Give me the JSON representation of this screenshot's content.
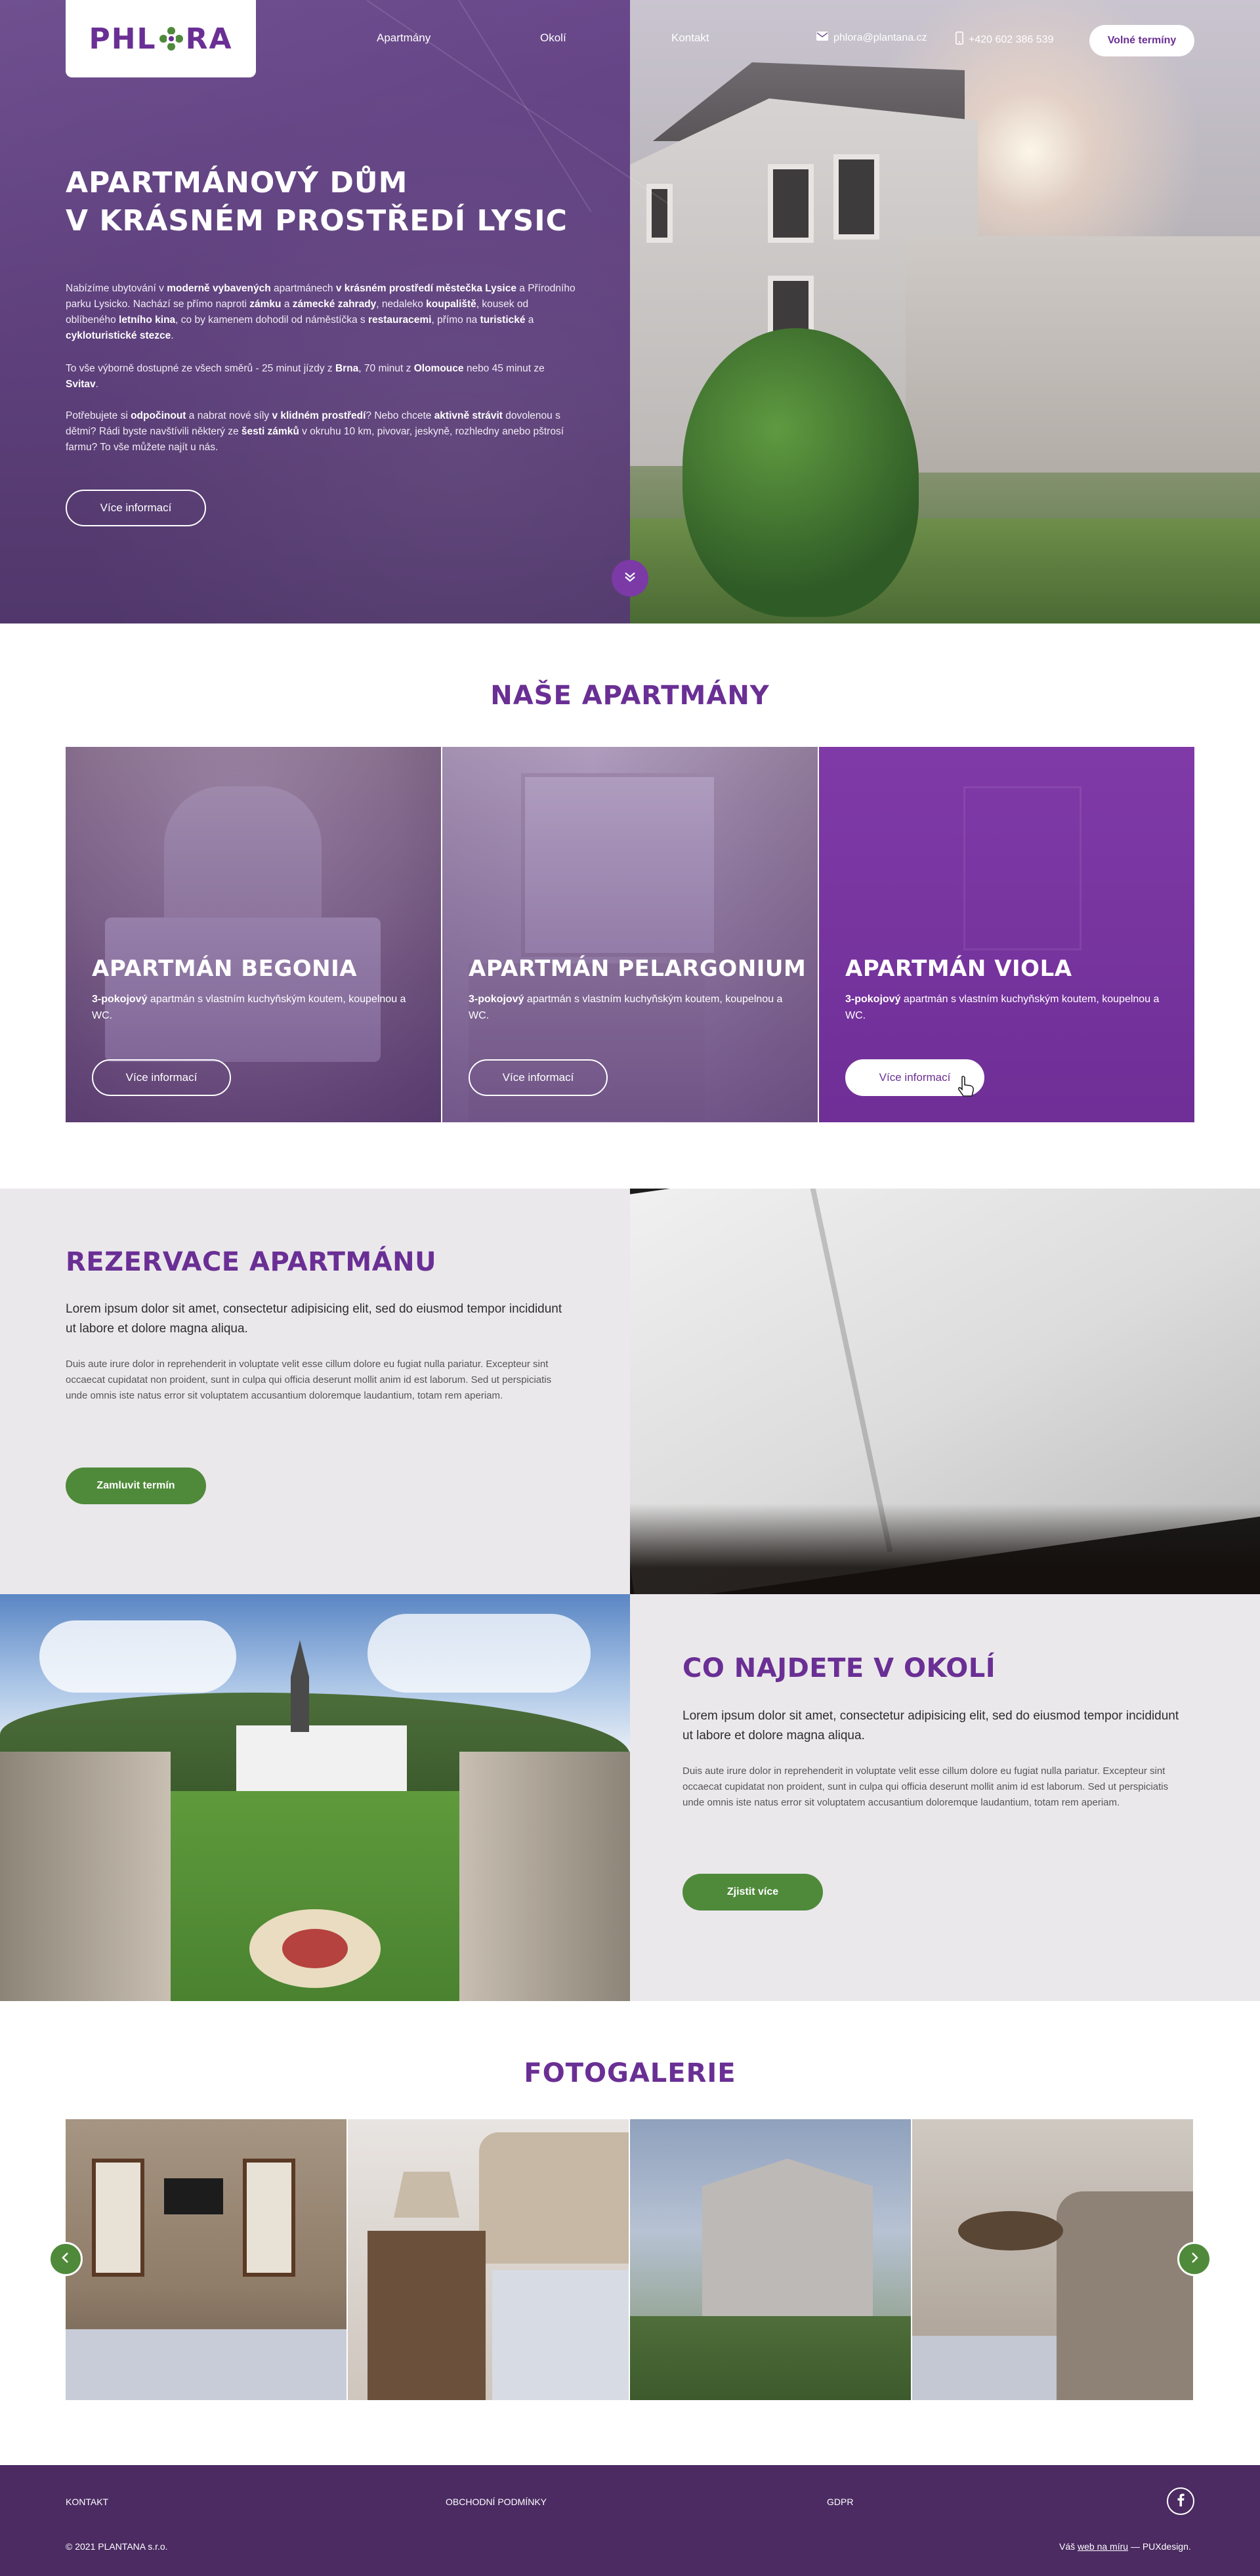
{
  "brand": {
    "logo_text_left": "PHL",
    "logo_text_right": "RA",
    "accent": "#6a2f94",
    "green": "#4f8a3a"
  },
  "nav": {
    "items": [
      "Apartmány",
      "Okolí",
      "Kontakt"
    ]
  },
  "contact": {
    "email": "phlora@plantana.cz",
    "phone": "+420 602 386 539",
    "email_icon": "envelope-icon",
    "phone_icon": "phone-icon"
  },
  "header": {
    "cta_label": "Volné termíny"
  },
  "hero": {
    "title_line1": "APARTMÁNOVÝ DŮM",
    "title_line2": "V KRÁSNÉM PROSTŘEDÍ LYSIC",
    "p1": {
      "t1": "Nabízíme ubytování v ",
      "b1": "moderně vybavených",
      "t2": " apartmánech ",
      "b2": "v krásném prostředí městečka Lysice",
      "t3": " a Přírodního parku Lysicko. Nachází se přímo naproti ",
      "b3": "zámku",
      "t4": " a ",
      "b4": "zámecké zahrady",
      "t5": ", nedaleko ",
      "b5": "koupaliště",
      "t6": ", kousek od oblíbeného ",
      "b6": "letního kina",
      "t7": ", co by kamenem dohodil od náměstíčka s ",
      "b7": "restauracemi",
      "t8": ", přímo na ",
      "b8": "turistické",
      "t9": " a ",
      "b9": "cykloturistické stezce",
      "t10": "."
    },
    "p2": {
      "t1": "To vše výborně dostupné ze všech směrů - 25 minut jízdy z ",
      "b1": "Brna",
      "t2": ", 70 minut z ",
      "b2": "Olomouce",
      "t3": " nebo 45 minut ze ",
      "b3": "Svitav",
      "t4": "."
    },
    "p3": {
      "t1": "Potřebujete si ",
      "b1": "odpočinout",
      "t2": " a nabrat nové síly ",
      "b2": "v klidném prostředí",
      "t3": "? Nebo chcete ",
      "b3": "aktivně strávit",
      "t4": " dovolenou s dětmi? Rádi byste navštívili některý ze ",
      "b4": "šesti zámků",
      "t5": " v okruhu 10 km, pivovar, jeskyně, rozhledny anebo pštrosí farmu? To vše můžete najít u nás."
    },
    "more_label": "Více informací",
    "scroll_icon": "double-chevron-down-icon"
  },
  "apartments": {
    "title": "NAŠE APARTMÁNY",
    "items": [
      {
        "name": "APARTMÁN BEGONIA",
        "desc_bold": "3-pokojový",
        "desc_rest": " apartmán s vlastním kuchyňským koutem, koupelnou a WC.",
        "button": "Více informací"
      },
      {
        "name": "APARTMÁN PELARGONIUM",
        "desc_bold": "3-pokojový",
        "desc_rest": " apartmán s vlastním kuchyňským koutem, koupelnou a WC.",
        "button": "Více informací"
      },
      {
        "name": "APARTMÁN VIOLA",
        "desc_bold": "3-pokojový",
        "desc_rest": " apartmán s vlastním kuchyňským koutem, koupelnou a WC.",
        "button": "Více informací"
      }
    ]
  },
  "reservation": {
    "title": "REZERVACE APARTMÁNU",
    "lead": "Lorem ipsum dolor sit amet, consectetur adipisicing elit, sed do eiusmod tempor incididunt ut labore et dolore magna aliqua.",
    "body": "Duis aute irure dolor in reprehenderit in voluptate velit esse cillum dolore eu fugiat nulla pariatur. Excepteur sint occaecat cupidatat non proident, sunt in culpa qui officia deserunt mollit anim id est laborum. Sed ut perspiciatis unde omnis iste natus error sit voluptatem accusantium doloremque laudantium, totam rem aperiam.",
    "button": "Zamluvit termín"
  },
  "surroundings": {
    "title": "CO NAJDETE V OKOLÍ",
    "lead": "Lorem ipsum dolor sit amet, consectetur adipisicing elit, sed do eiusmod tempor incididunt ut labore et dolore magna aliqua.",
    "body": "Duis aute irure dolor in reprehenderit in voluptate velit esse cillum dolore eu fugiat nulla pariatur. Excepteur sint occaecat cupidatat non proident, sunt in culpa qui officia deserunt mollit anim id est laborum. Sed ut perspiciatis unde omnis iste natus error sit voluptatem accusantium doloremque laudantium, totam rem aperiam.",
    "button": "Zjistit více"
  },
  "gallery": {
    "title": "FOTOGALERIE",
    "prev_icon": "chevron-left-icon",
    "next_icon": "chevron-right-icon"
  },
  "footer": {
    "links": [
      "KONTAKT",
      "OBCHODNÍ PODMÍNKY",
      "GDPR"
    ],
    "copyright": "© 2021 PLANTANA s.r.o.",
    "credit_prefix": "Váš ",
    "credit_link": "web na míru",
    "credit_suffix": " — PUXdesign.",
    "social_icon": "facebook-icon"
  }
}
